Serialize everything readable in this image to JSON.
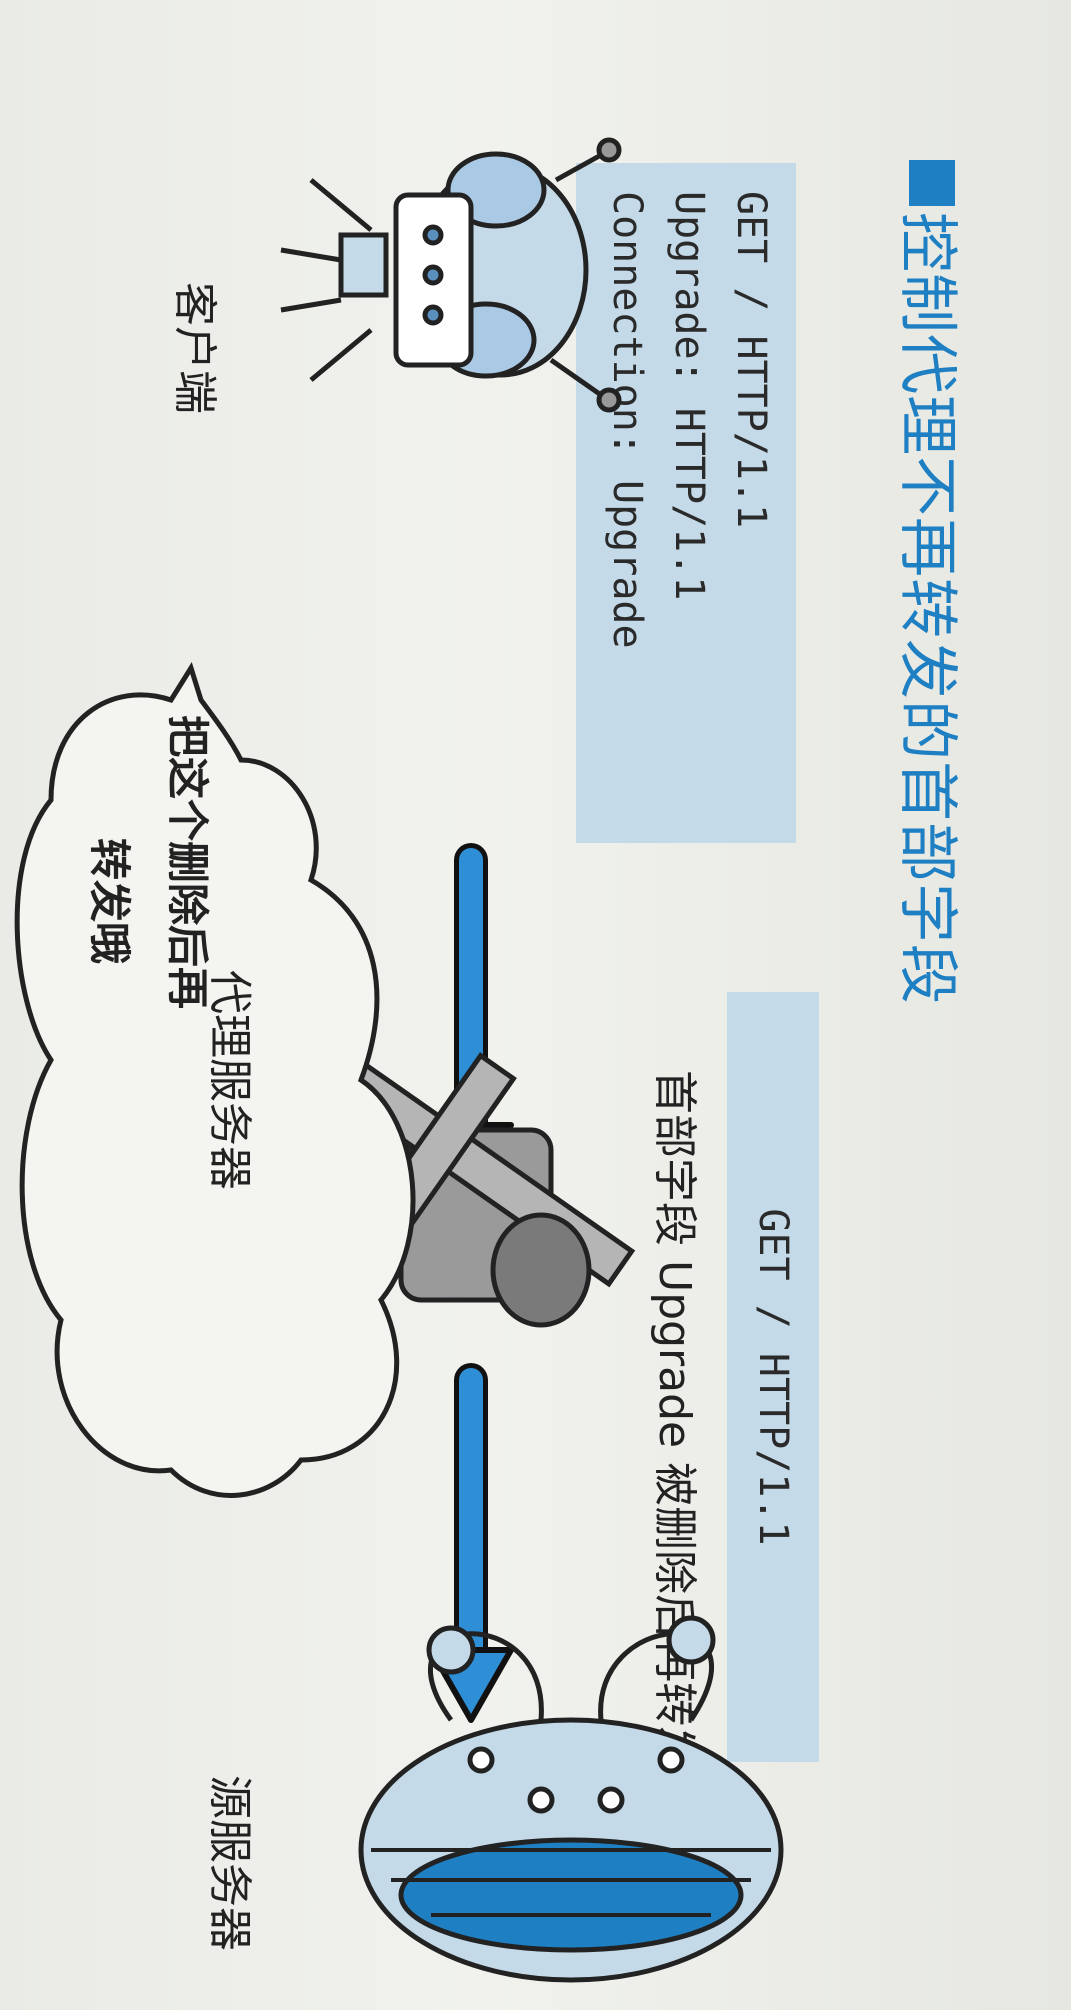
{
  "title": "控制代理不再转发的首部字段",
  "client_request": {
    "line1": "GET / HTTP/1.1",
    "line2": "Upgrade: HTTP/1.1",
    "line3": "Connection: Upgrade"
  },
  "proxy_request": {
    "line1": "GET / HTTP/1.1",
    "note": "首部字段 Upgrade 被删除后再转发"
  },
  "speech_bubble": {
    "line1": "把这个删除后再",
    "line2": "转发哦"
  },
  "nodes": {
    "client": "客户端",
    "proxy": "代理服务器",
    "origin": "源服务器"
  },
  "colors": {
    "accent": "#1f7fc3",
    "code_box": "#c4dae8",
    "arrow": "#2f8fd6"
  }
}
